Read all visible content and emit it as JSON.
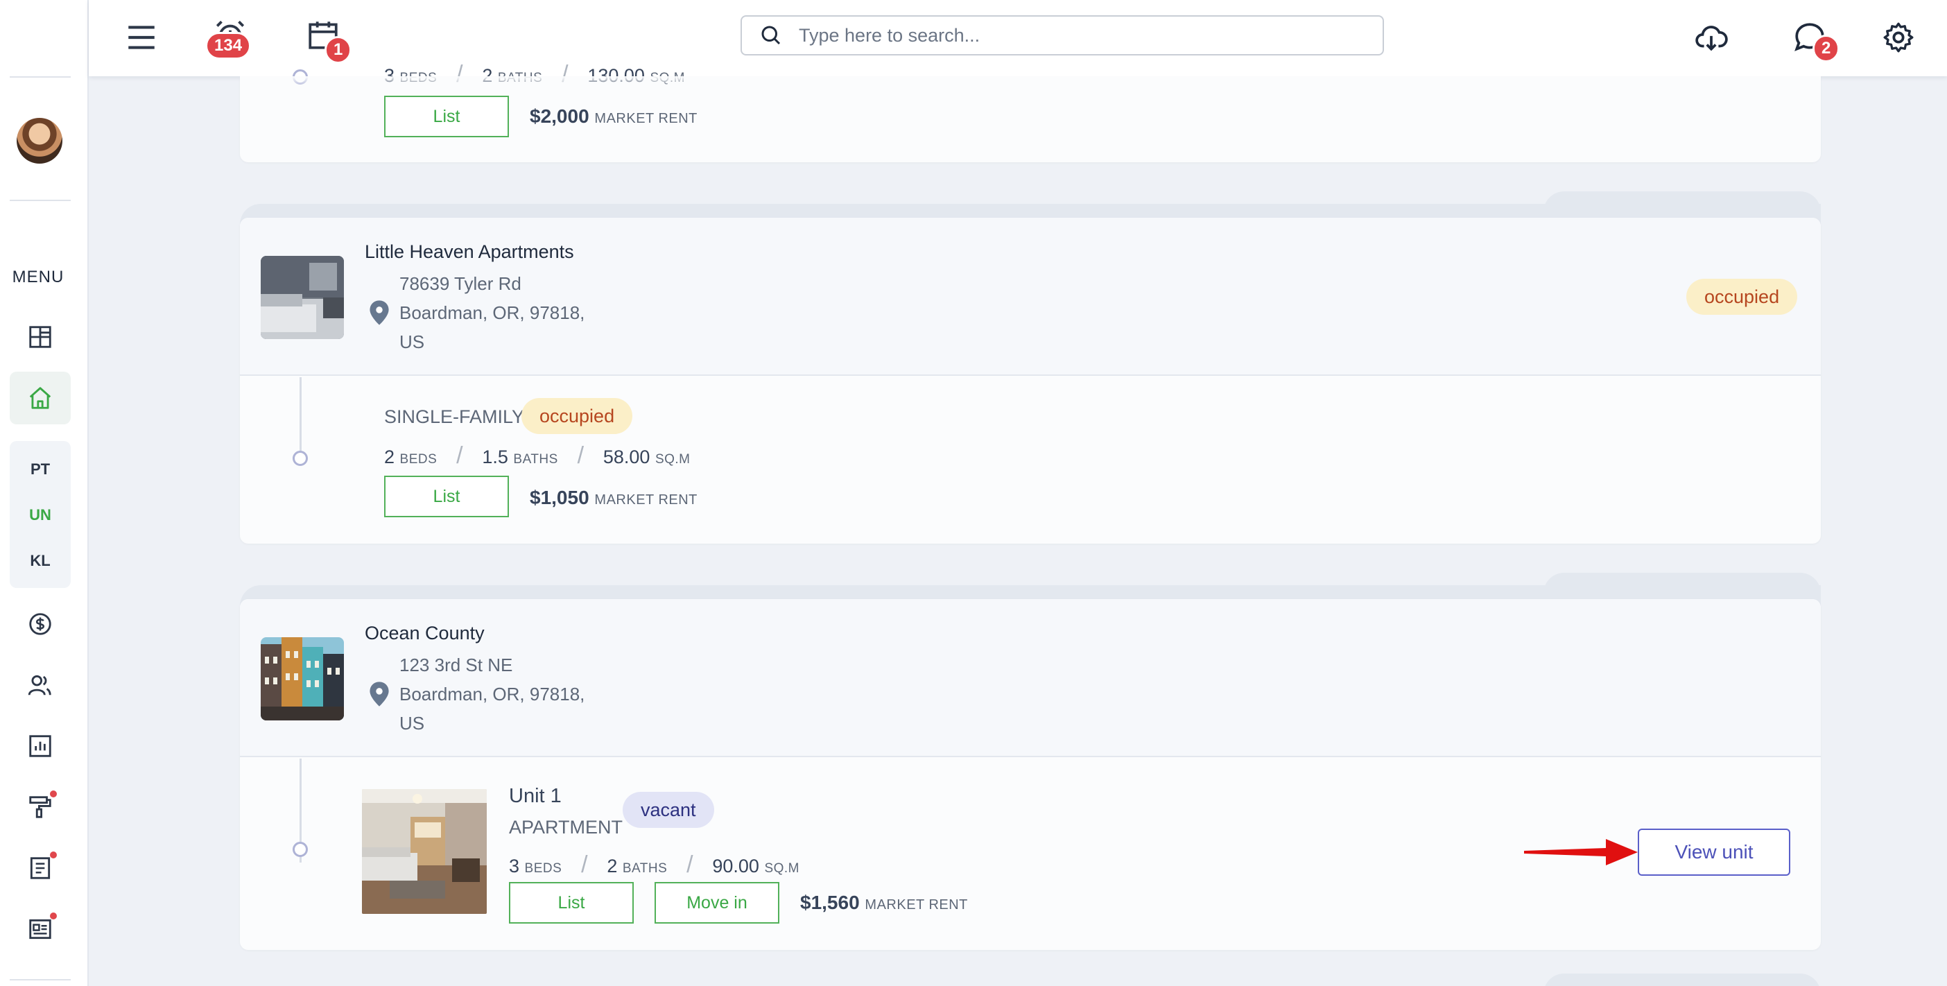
{
  "topbar": {
    "alarm_badge": "134",
    "calendar_badge": "1",
    "messages_badge": "2",
    "search_placeholder": "Type here to search..."
  },
  "sidebar": {
    "menu_label": "MENU",
    "group_items": [
      "PT",
      "UN",
      "KL"
    ]
  },
  "properties": [
    {
      "name": "",
      "units": [
        {
          "beds": "3",
          "beds_label": "BEDS",
          "baths": "2",
          "baths_label": "BATHS",
          "area": "130.00",
          "area_label": "SQ.M",
          "list_label": "List",
          "rent": "$2,000",
          "rent_label": "MARKET RENT"
        }
      ]
    },
    {
      "name": "Little Heaven Apartments",
      "address_line1": "78639 Tyler Rd",
      "address_line2": "Boardman, OR, 97818,",
      "address_line3": "US",
      "status": "occupied",
      "units": [
        {
          "type": "SINGLE-FAMILY",
          "status": "occupied",
          "beds": "2",
          "beds_label": "BEDS",
          "baths": "1.5",
          "baths_label": "BATHS",
          "area": "58.00",
          "area_label": "SQ.M",
          "list_label": "List",
          "rent": "$1,050",
          "rent_label": "MARKET RENT"
        }
      ]
    },
    {
      "name": "Ocean County",
      "address_line1": "123 3rd St NE",
      "address_line2": "Boardman, OR, 97818,",
      "address_line3": "US",
      "units": [
        {
          "name": "Unit 1",
          "type": "APARTMENT",
          "status": "vacant",
          "beds": "3",
          "beds_label": "BEDS",
          "baths": "2",
          "baths_label": "BATHS",
          "area": "90.00",
          "area_label": "SQ.M",
          "list_label": "List",
          "move_in_label": "Move in",
          "rent": "$1,560",
          "rent_label": "MARKET RENT",
          "view_unit_label": "View unit"
        }
      ]
    }
  ],
  "colors": {
    "accent_green": "#3aa845",
    "accent_indigo": "#4c51b8",
    "badge_red": "#e04348",
    "arrow_red": "#e01010"
  }
}
